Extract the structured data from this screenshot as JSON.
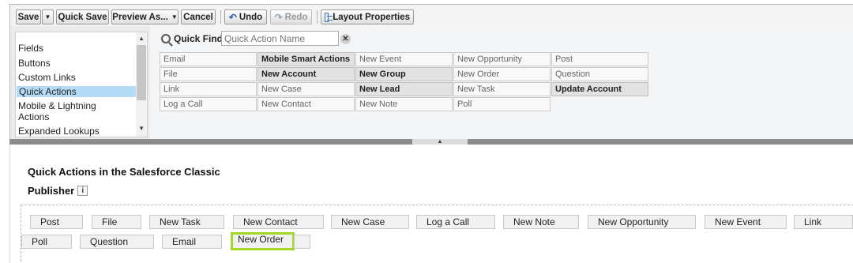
{
  "toolbar": {
    "save": "Save",
    "quick_save": "Quick Save",
    "preview_as": "Preview As...",
    "cancel": "Cancel",
    "undo": "Undo",
    "redo": "Redo",
    "layout_properties": "Layout Properties"
  },
  "palette": {
    "categories": [
      "Fields",
      "Buttons",
      "Custom Links",
      "Quick Actions",
      "Mobile & Lightning Actions",
      "Expanded Lookups"
    ],
    "selected_category": "Quick Actions",
    "quick_find_label": "Quick Find",
    "quick_find_placeholder": "Quick Action Name",
    "actions": [
      [
        "Email",
        "Mobile Smart Actions",
        "New Event",
        "New Opportunity",
        "Post"
      ],
      [
        "File",
        "New Account",
        "New Group",
        "New Order",
        "Question"
      ],
      [
        "Link",
        "New Case",
        "New Lead",
        "New Task",
        "Update Account"
      ],
      [
        "Log a Call",
        "New Contact",
        "New Note",
        "Poll",
        ""
      ]
    ],
    "used_actions": [
      "Mobile Smart Actions",
      "New Account",
      "New Group",
      "New Lead",
      "Update Account"
    ]
  },
  "section": {
    "title_line1": "Quick Actions in the Salesforce Classic",
    "title_line2": "Publisher",
    "info_icon": "i"
  },
  "publisher": {
    "row1": [
      "Post",
      "File",
      "New Task",
      "New Contact",
      "New Case",
      "Log a Call",
      "New Note",
      "New Opportunity",
      "New Event",
      "Link"
    ],
    "row2": [
      "Poll",
      "Question",
      "Email",
      "New Order",
      ""
    ],
    "highlighted": "New Order",
    "highlight_color": "#a3d82a"
  }
}
